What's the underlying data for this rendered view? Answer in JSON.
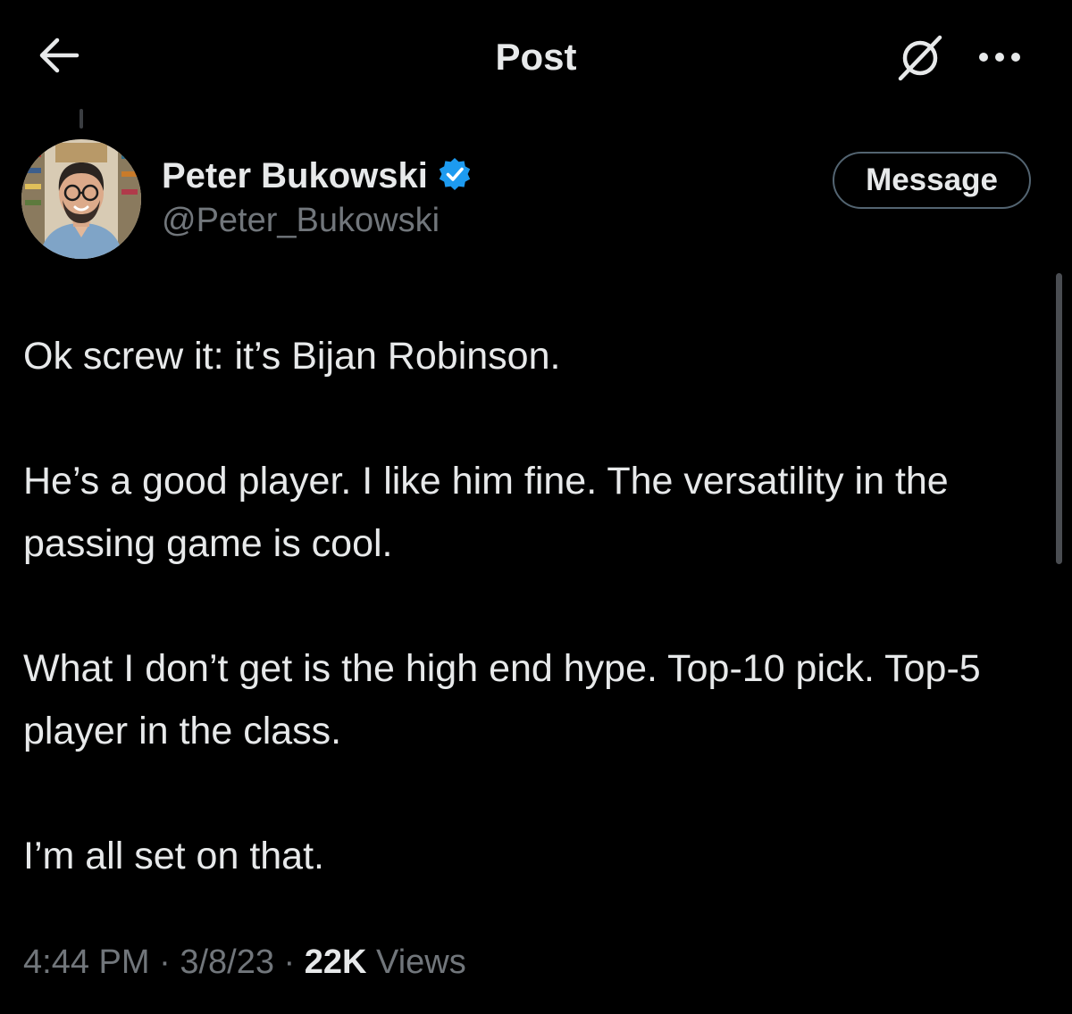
{
  "header": {
    "title": "Post",
    "back_icon": "back-arrow-icon",
    "grok_icon": "grok-icon",
    "more_icon": "more-icon"
  },
  "author": {
    "display_name": "Peter Bukowski",
    "handle": "@Peter_Bukowski",
    "verified": true,
    "verified_color": "#1d9bf0",
    "message_label": "Message"
  },
  "post": {
    "paragraphs": [
      "Ok screw it: it’s Bijan Robinson.",
      "He’s a good player. I like him fine. The versatility in the passing game is cool.",
      "What I don’t get is the high end hype. Top-10 pick. Top-5 player in the class.",
      "I’m all set on that."
    ]
  },
  "meta": {
    "time": "4:44 PM",
    "separator": "·",
    "date": "3/8/23",
    "views_count": "22K",
    "views_label": "Views"
  },
  "colors": {
    "background": "#000000",
    "text_primary": "#e7e9ea",
    "text_secondary": "#71767b",
    "button_border": "#536471"
  }
}
